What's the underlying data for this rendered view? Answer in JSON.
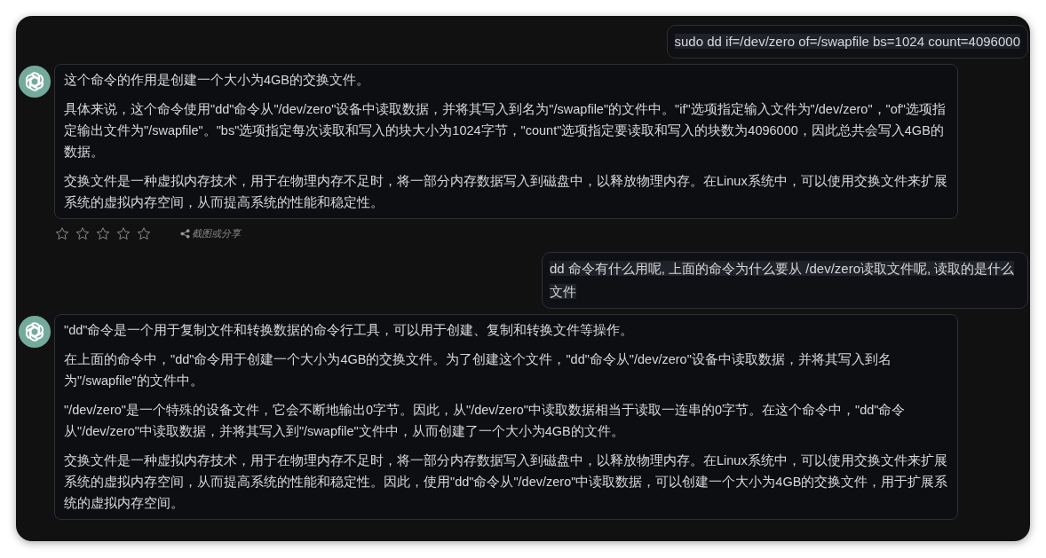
{
  "messages": [
    {
      "kind": "user",
      "text": "sudo dd if=/dev/zero of=/swapfile bs=1024 count=4096000"
    },
    {
      "kind": "assistant",
      "paragraphs": [
        "这个命令的作用是创建一个大小为4GB的交换文件。",
        "具体来说，这个命令使用\"dd\"命令从\"/dev/zero\"设备中读取数据，并将其写入到名为\"/swapfile\"的文件中。\"if\"选项指定输入文件为\"/dev/zero\"，\"of\"选项指定输出文件为\"/swapfile\"。\"bs\"选项指定每次读取和写入的块大小为1024字节，\"count\"选项指定要读取和写入的块数为4096000，因此总共会写入4GB的数据。",
        "交换文件是一种虚拟内存技术，用于在物理内存不足时，将一部分内存数据写入到磁盘中，以释放物理内存。在Linux系统中，可以使用交换文件来扩展系统的虚拟内存空间，从而提高系统的性能和稳定性。"
      ],
      "rating": {
        "stars": 0,
        "share": "截图或分享"
      }
    },
    {
      "kind": "user",
      "text": "dd 命令有什么用呢, 上面的命令为什么要从 /dev/zero读取文件呢, 读取的是什么文件"
    },
    {
      "kind": "assistant",
      "paragraphs": [
        "\"dd\"命令是一个用于复制文件和转换数据的命令行工具，可以用于创建、复制和转换文件等操作。",
        "在上面的命令中，\"dd\"命令用于创建一个大小为4GB的交换文件。为了创建这个文件，\"dd\"命令从\"/dev/zero\"设备中读取数据，并将其写入到名为\"/swapfile\"的文件中。",
        "\"/dev/zero\"是一个特殊的设备文件，它会不断地输出0字节。因此，从\"/dev/zero\"中读取数据相当于读取一连串的0字节。在这个命令中，\"dd\"命令从\"/dev/zero\"中读取数据，并将其写入到\"/swapfile\"文件中，从而创建了一个大小为4GB的文件。",
        "交换文件是一种虚拟内存技术，用于在物理内存不足时，将一部分内存数据写入到磁盘中，以释放物理内存。在Linux系统中，可以使用交换文件来扩展系统的虚拟内存空间，从而提高系统的性能和稳定性。因此，使用\"dd\"命令从\"/dev/zero\"中读取数据，可以创建一个大小为4GB的交换文件，用于扩展系统的虚拟内存空间。"
      ]
    }
  ]
}
